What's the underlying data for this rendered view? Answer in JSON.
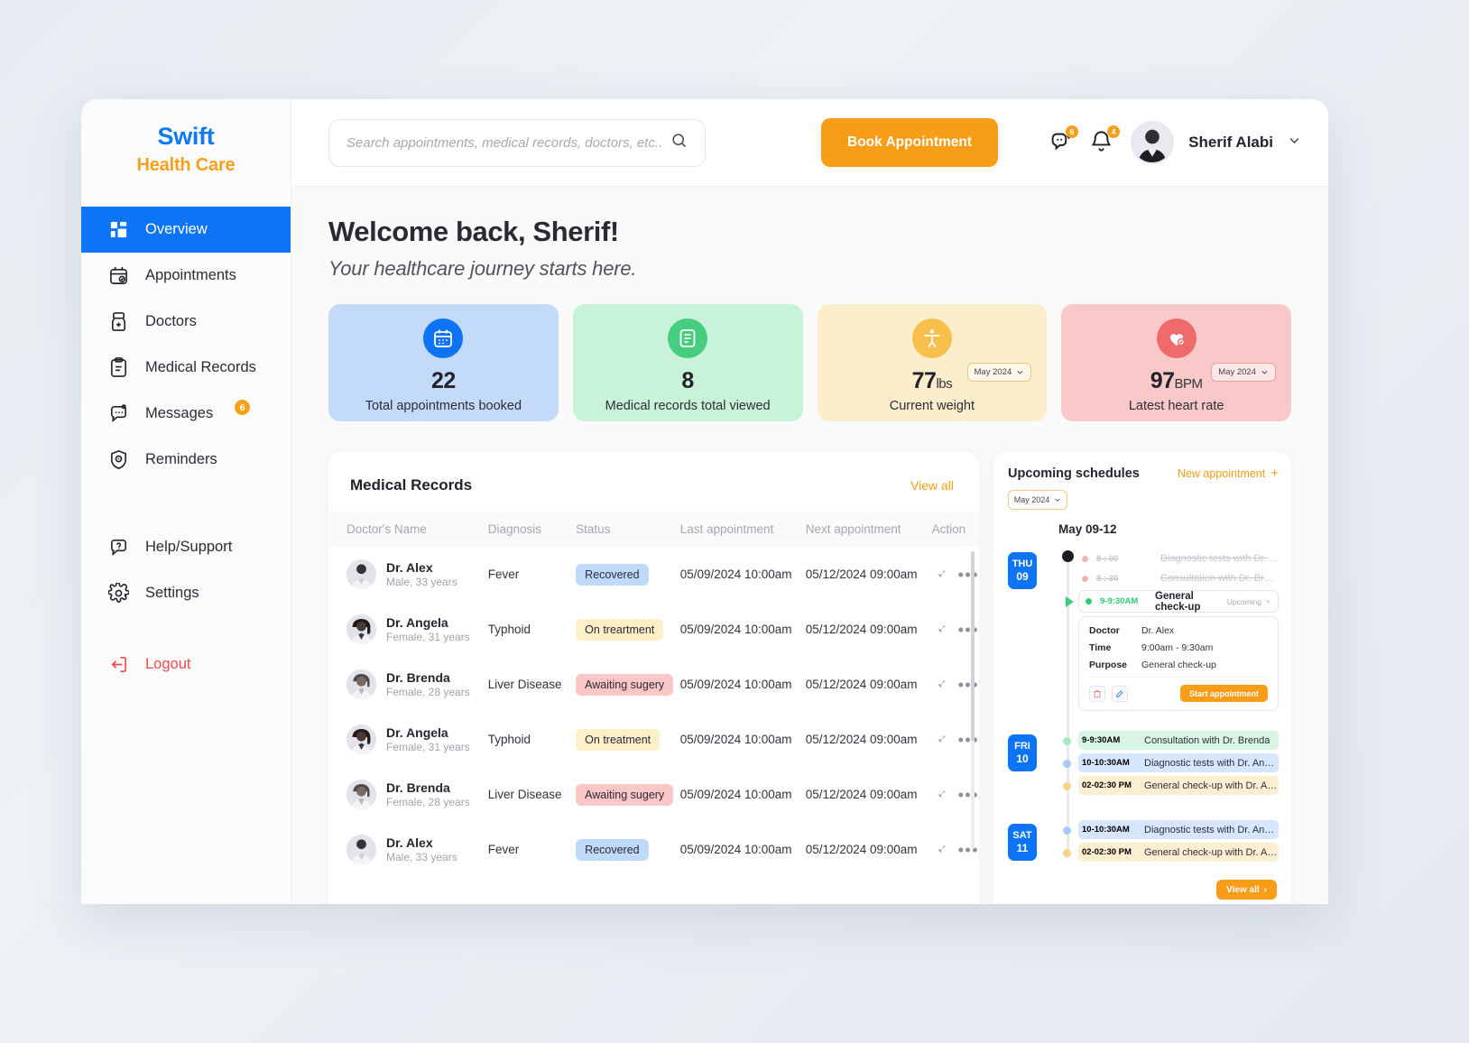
{
  "brand": {
    "top": "Swift",
    "bottom": "Health Care"
  },
  "sidebar": {
    "items": [
      {
        "label": "Overview",
        "icon": "grid-icon",
        "active": true
      },
      {
        "label": "Appointments",
        "icon": "calendar-check-icon"
      },
      {
        "label": "Doctors",
        "icon": "doctor-icon"
      },
      {
        "label": "Medical Records",
        "icon": "clipboard-icon"
      },
      {
        "label": "Messages",
        "icon": "chat-icon",
        "badge": "6"
      },
      {
        "label": "Reminders",
        "icon": "shield-alert-icon"
      },
      {
        "label": "Help/Support",
        "icon": "question-chat-icon"
      },
      {
        "label": "Settings",
        "icon": "gear-icon"
      }
    ],
    "logout": {
      "label": "Logout",
      "icon": "logout-icon"
    }
  },
  "topbar": {
    "search_placeholder": "Search appointments, medical records, doctors, etc...",
    "search_value": "",
    "search_icon": "search-icon",
    "book_button": "Book Appointment",
    "messages_badge": "6",
    "notifications_badge": "4",
    "user_name": "Sherif Alabi"
  },
  "hero": {
    "welcome": "Welcome back, Sherif!",
    "subtitle": "Your healthcare journey starts here."
  },
  "stats": [
    {
      "value": "22",
      "unit": "",
      "label": "Total appointments booked",
      "icon": "calendar-icon",
      "bg": "#c3daf9",
      "icon_bg": "#0d74f5",
      "select": null
    },
    {
      "value": "8",
      "unit": "",
      "label": "Medical records total viewed",
      "icon": "note-edit-icon",
      "bg": "#c8f3d8",
      "icon_bg": "#46cd80",
      "select": null
    },
    {
      "value": "77",
      "unit": "lbs",
      "label": "Current weight",
      "icon": "body-icon",
      "bg": "#fceecc",
      "icon_bg": "#f8bf4c",
      "select": "May 2024"
    },
    {
      "value": "97",
      "unit": "BPM",
      "label": "Latest heart rate",
      "icon": "heart-check-icon",
      "bg": "#f9c9c9",
      "icon_bg": "#ef6a6a",
      "select": "May 2024"
    }
  ],
  "records": {
    "title": "Medical Records",
    "view_all": "View all",
    "columns": [
      "Doctor's Name",
      "Diagnosis",
      "Status",
      "Last appointment",
      "Next appointment",
      "Action"
    ],
    "rows": [
      {
        "name": "Dr. Alex",
        "meta": "Male, 33 years",
        "avatar": "male",
        "diagnosis": "Fever",
        "status": "Recovered",
        "status_bg": "#bfd9fb",
        "last": "05/09/2024 10:00am",
        "next": "05/12/2024 09:00am"
      },
      {
        "name": "Dr. Angela",
        "meta": "Female, 31 years",
        "avatar": "female-dark",
        "diagnosis": "Typhoid",
        "status": "On treartment",
        "status_bg": "#fdefc8",
        "last": "05/09/2024 10:00am",
        "next": "05/12/2024 09:00am"
      },
      {
        "name": "Dr. Brenda",
        "meta": "Female, 28 years",
        "avatar": "female-light",
        "diagnosis": "Liver Disease",
        "status": "Awaiting sugery",
        "status_bg": "#fbc6c6",
        "last": "05/09/2024 10:00am",
        "next": "05/12/2024 09:00am"
      },
      {
        "name": "Dr. Angela",
        "meta": "Female, 31 years",
        "avatar": "female-dark",
        "diagnosis": "Typhoid",
        "status": "On treatment",
        "status_bg": "#fdefc8",
        "last": "05/09/2024 10:00am",
        "next": "05/12/2024 09:00am"
      },
      {
        "name": "Dr. Brenda",
        "meta": "Female, 28 years",
        "avatar": "female-light",
        "diagnosis": "Liver Disease",
        "status": "Awaiting sugery",
        "status_bg": "#fbc6c6",
        "last": "05/09/2024 10:00am",
        "next": "05/12/2024 09:00am"
      },
      {
        "name": "Dr. Alex",
        "meta": "Male, 33 years",
        "avatar": "male",
        "diagnosis": "Fever",
        "status": "Recovered",
        "status_bg": "#bfd9fb",
        "last": "05/09/2024 10:00am",
        "next": "05/12/2024 09:00am"
      }
    ]
  },
  "schedules": {
    "title": "Upcoming schedules",
    "new_appointment": "New appointment",
    "month_select": "May 2024",
    "range_label": "May 09-12",
    "view_all": "View all",
    "days": [
      {
        "dow": "THU",
        "dom": "09",
        "events": [
          {
            "time": "8 : 00",
            "text": "Diagnostic tests with Dr. Angela",
            "state": "done"
          },
          {
            "time": "8 : 30",
            "text": "Consultation with Dr. Brenda",
            "state": "done"
          }
        ],
        "current": {
          "time": "9-9:30AM",
          "title": "General check-up",
          "badge": "Upcoming",
          "details": [
            {
              "key": "Doctor",
              "value": "Dr. Alex"
            },
            {
              "key": "Time",
              "value": "9:00am - 9:30am"
            },
            {
              "key": "Purpose",
              "value": "General check-up"
            }
          ],
          "start_button": "Start appointment"
        }
      },
      {
        "dow": "FRI",
        "dom": "10",
        "events": [
          {
            "time": "9-9:30AM",
            "text": "Consultation with Dr. Brenda",
            "bg": "#d9f6e4",
            "dot": "#62d79b"
          },
          {
            "time": "10-10:30AM",
            "text": "Diagnostic tests with Dr. Angela",
            "bg": "#d6e6fd",
            "dot": "#8fb9f4"
          },
          {
            "time": "02-02:30 PM",
            "text": "General check-up with Dr. Alex",
            "bg": "#fdf0d2",
            "dot": "#f6cb6c"
          }
        ]
      },
      {
        "dow": "SAT",
        "dom": "11",
        "events": [
          {
            "time": "10-10:30AM",
            "text": "Diagnostic tests with Dr. Angela",
            "bg": "#d6e6fd",
            "dot": "#8fb9f4"
          },
          {
            "time": "02-02:30 PM",
            "text": "General check-up with Dr. Alex",
            "bg": "#fdf0d2",
            "dot": "#f6cb6c"
          }
        ]
      }
    ]
  }
}
